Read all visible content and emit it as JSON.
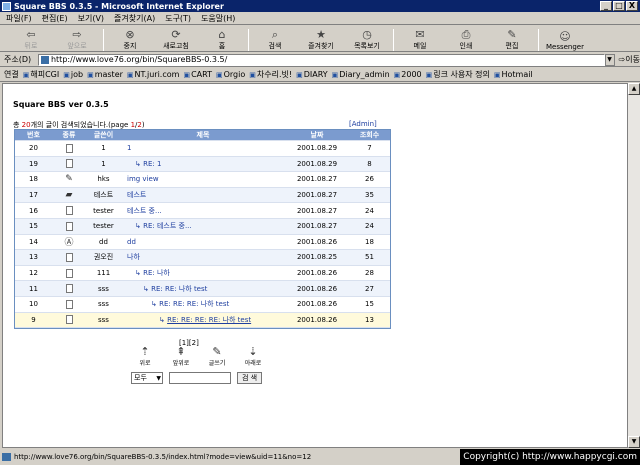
{
  "window": {
    "title": "Square BBS 0.3.5 - Microsoft Internet Explorer",
    "min": "_",
    "max": "□",
    "close": "X"
  },
  "menu": [
    "파일(F)",
    "편집(E)",
    "보기(V)",
    "즐겨찾기(A)",
    "도구(T)",
    "도움말(H)"
  ],
  "toolbar": [
    {
      "label": "뒤로",
      "glyph": "⇦",
      "icon": "back-arrow",
      "disabled": true
    },
    {
      "label": "앞으로",
      "glyph": "⇨",
      "icon": "forward-arrow",
      "disabled": true
    },
    {
      "label": "중지",
      "glyph": "⊗",
      "icon": "stop"
    },
    {
      "label": "새로고침",
      "glyph": "⟳",
      "icon": "refresh"
    },
    {
      "label": "홈",
      "glyph": "⌂",
      "icon": "home"
    },
    {
      "label": "검색",
      "glyph": "⌕",
      "icon": "search"
    },
    {
      "label": "즐겨찾기",
      "glyph": "★",
      "icon": "favorites"
    },
    {
      "label": "목록보기",
      "glyph": "◷",
      "icon": "history"
    },
    {
      "label": "메일",
      "glyph": "✉",
      "icon": "mail"
    },
    {
      "label": "인쇄",
      "glyph": "⎙",
      "icon": "print"
    },
    {
      "label": "편집",
      "glyph": "✎",
      "icon": "edit"
    },
    {
      "label": "Messenger",
      "glyph": "☺",
      "icon": "messenger"
    }
  ],
  "address": {
    "label": "주소(D)",
    "url": "http://www.love76.org/bin/SquareBBS-0.3.5/",
    "go": "이동"
  },
  "links": {
    "label": "연결",
    "items": [
      "해피CGI",
      "job",
      "master",
      "NT.juri.com",
      "CART",
      "Orgio",
      "차수리.빗!",
      "DIARY",
      "Diary_admin",
      "2000",
      "링크 사용자 정의",
      "Hotmail"
    ]
  },
  "bbs": {
    "title": "Square BBS ver 0.3.5",
    "counter_prefix": "총 ",
    "count": "20",
    "counter_mid": "개의 글이 검색되었습니다.(page ",
    "page_cur": "1",
    "page_sep": "/",
    "page_total": "2",
    "counter_suffix": ")",
    "admin": "[Admin]",
    "headers": {
      "no": "번호",
      "type": "종류",
      "author": "글쓴이",
      "title": "제목",
      "date": "날짜",
      "views": "조회수"
    },
    "rows": [
      {
        "no": "20",
        "icon": "doc",
        "author": "1",
        "title": "1",
        "date": "2001.08.29",
        "views": "7",
        "depth": 0
      },
      {
        "no": "19",
        "icon": "doc",
        "author": "1",
        "title": "RE: 1",
        "date": "2001.08.29",
        "views": "8",
        "depth": 1
      },
      {
        "no": "18",
        "icon": "pencil",
        "author": "hks",
        "title": "img view",
        "date": "2001.08.27",
        "views": "26",
        "depth": 0
      },
      {
        "no": "17",
        "icon": "folder",
        "author": "테스트",
        "title": "테스트",
        "date": "2001.08.27",
        "views": "35",
        "depth": 0
      },
      {
        "no": "16",
        "icon": "doc",
        "author": "tester",
        "title": "테스트 중...",
        "date": "2001.08.27",
        "views": "24",
        "depth": 0
      },
      {
        "no": "15",
        "icon": "doc",
        "author": "tester",
        "title": "RE: 테스트 중...",
        "date": "2001.08.27",
        "views": "24",
        "depth": 1
      },
      {
        "no": "14",
        "icon": "at",
        "author": "dd",
        "title": "dd",
        "date": "2001.08.26",
        "views": "18",
        "depth": 0
      },
      {
        "no": "13",
        "icon": "doc",
        "author": "권오진",
        "title": "나하",
        "date": "2001.08.25",
        "views": "51",
        "depth": 0
      },
      {
        "no": "12",
        "icon": "doc",
        "author": "111",
        "title": "RE: 나하",
        "date": "2001.08.26",
        "views": "28",
        "depth": 1
      },
      {
        "no": "11",
        "icon": "doc",
        "author": "sss",
        "title": "RE: RE: 나하 test",
        "date": "2001.08.26",
        "views": "27",
        "depth": 2
      },
      {
        "no": "10",
        "icon": "doc",
        "author": "sss",
        "title": "RE: RE: RE: 나하 test",
        "date": "2001.08.26",
        "views": "15",
        "depth": 3
      },
      {
        "no": "9",
        "icon": "doc",
        "author": "sss",
        "title": "RE: RE: RE: RE: 나하 test",
        "date": "2001.08.26",
        "views": "13",
        "depth": 4
      }
    ],
    "pager": "[1][2]",
    "actions": [
      {
        "label": "위로",
        "glyph": "⇡"
      },
      {
        "label": "앞위로",
        "glyph": "⇞"
      },
      {
        "label": "글쓰기",
        "glyph": "✎"
      },
      {
        "label": "아래로",
        "glyph": "⇣"
      }
    ],
    "search": {
      "scope": "모두",
      "button": "검 색"
    }
  },
  "status": "http://www.love76.org/bin/SquareBBS-0.3.5/index.html?mode=view&uid=11&no=12",
  "copyright": "Copyright(c) http://www.happycgi.com"
}
